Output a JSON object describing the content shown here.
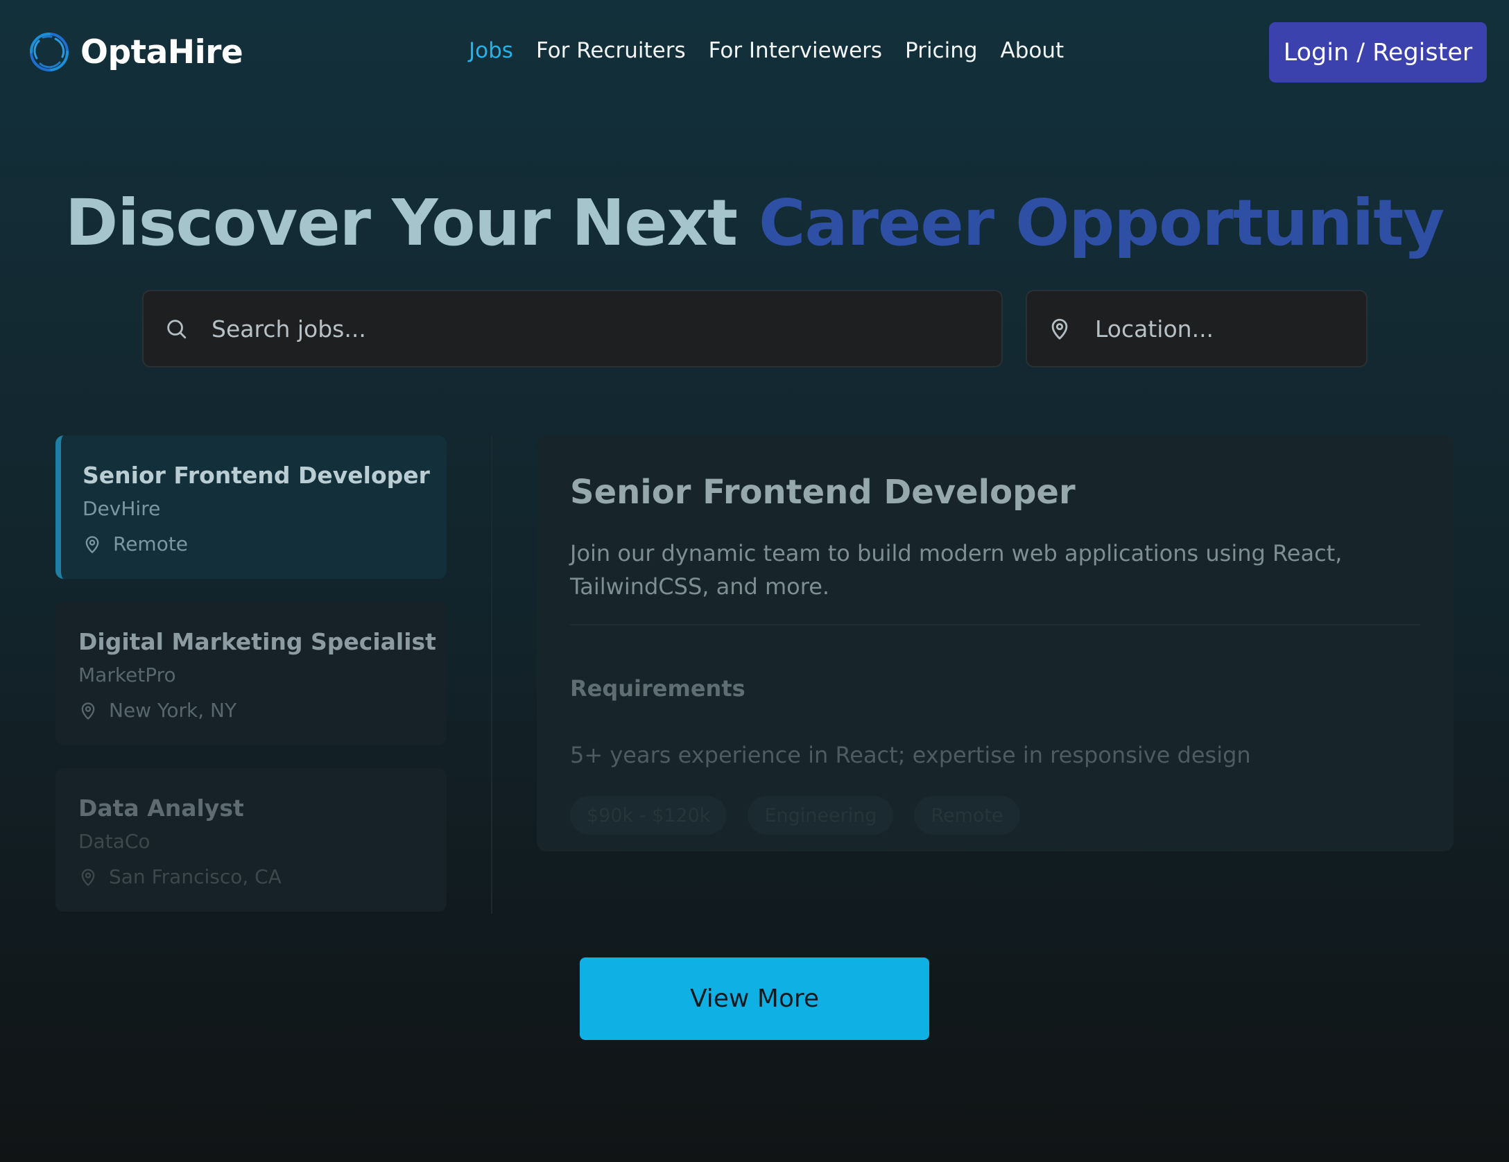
{
  "brand": {
    "name": "OptaHire",
    "logo_icon": "swirl-logo-icon",
    "accent_color": "#0fb0e3",
    "primary_color": "#3b41ad"
  },
  "nav": {
    "items": [
      {
        "label": "Jobs",
        "active": true
      },
      {
        "label": "For Recruiters",
        "active": false
      },
      {
        "label": "For Interviewers",
        "active": false
      },
      {
        "label": "Pricing",
        "active": false
      },
      {
        "label": "About",
        "active": false
      }
    ],
    "login_label": "Login / Register"
  },
  "hero": {
    "title_main": "Discover Your Next ",
    "title_accent": "Career Opportunity"
  },
  "search": {
    "placeholder": "Search jobs...",
    "location_placeholder": "Location...",
    "search_icon": "search-icon",
    "location_icon": "map-pin-icon"
  },
  "jobs": [
    {
      "title": "Senior Frontend Developer",
      "company": "DevHire",
      "location": "Remote",
      "selected": true
    },
    {
      "title": "Digital Marketing Specialist",
      "company": "MarketPro",
      "location": "New York, NY",
      "selected": false
    },
    {
      "title": "Data Analyst",
      "company": "DataCo",
      "location": "San Francisco, CA",
      "selected": false
    }
  ],
  "detail": {
    "title": "Senior Frontend Developer",
    "description": "Join our dynamic team to build modern web applications using React, TailwindCSS, and more.",
    "requirements_heading": "Requirements",
    "requirements": "5+ years experience in React; expertise in responsive design",
    "tags": [
      "$90k - $120k",
      "Engineering",
      "Remote"
    ]
  },
  "actions": {
    "view_more_label": "View More"
  }
}
